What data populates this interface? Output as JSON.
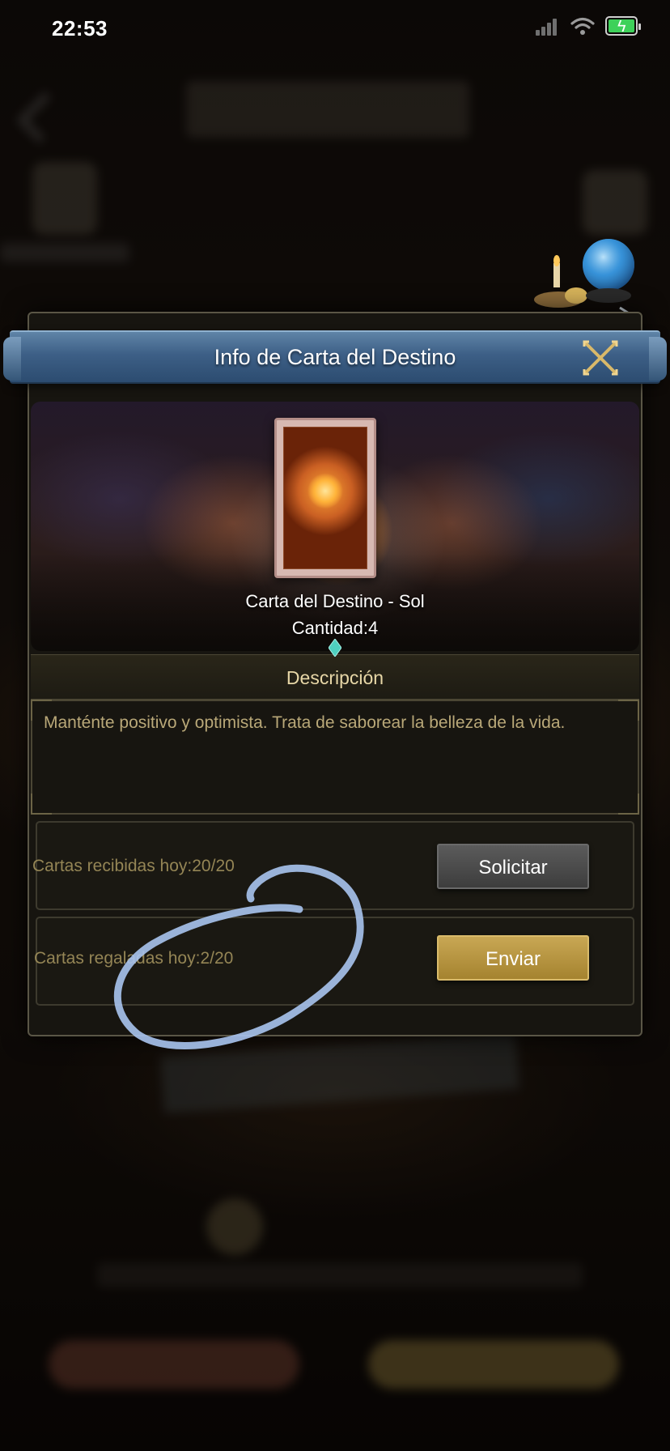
{
  "status_bar": {
    "time": "22:53"
  },
  "dialog": {
    "title": "Info de Carta del Destino",
    "card": {
      "name": "Carta del Destino - Sol",
      "quantity_label": "Cantidad:4"
    },
    "description": {
      "header": "Descripción",
      "text": "Manténte positivo y optimista. Trata de saborear la belleza de la vida."
    },
    "received": {
      "label": "Cartas recibidas hoy:20/20",
      "button": "Solicitar"
    },
    "gifted": {
      "label": "Cartas regaladas hoy:2/20",
      "button": "Enviar"
    }
  },
  "colors": {
    "title_banner": "#3d5f86",
    "gold_button": "#c8a754",
    "grey_button": "#4b4b4b",
    "label_text": "#948555",
    "scribble": "#a9c4ef"
  },
  "icons": [
    "close-icon",
    "cellular-signal-icon",
    "wifi-icon",
    "battery-charging-icon",
    "crystal-ball-icon",
    "gem-icon"
  ]
}
